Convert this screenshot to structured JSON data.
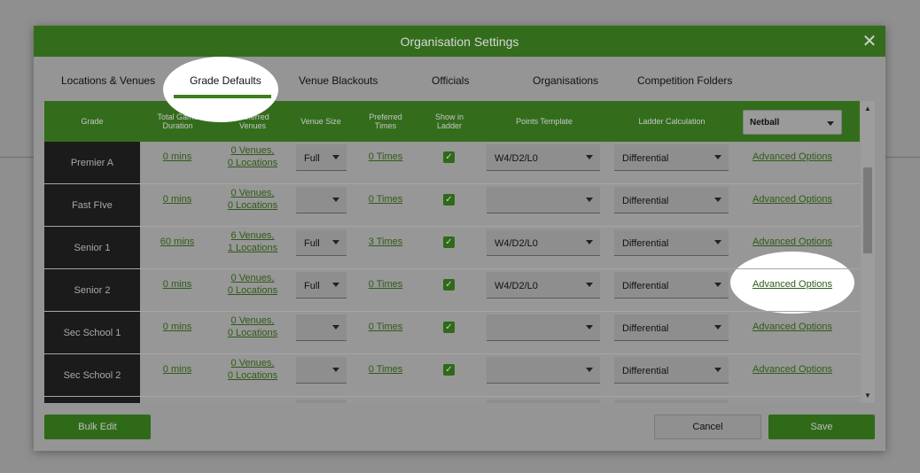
{
  "modal": {
    "title": "Organisation Settings",
    "close_glyph": "✕"
  },
  "tabs": [
    {
      "label": "Locations & Venues"
    },
    {
      "label": "Grade Defaults"
    },
    {
      "label": "Venue Blackouts"
    },
    {
      "label": "Officials"
    },
    {
      "label": "Organisations"
    },
    {
      "label": "Competition Folders"
    }
  ],
  "grid": {
    "headers": {
      "grade": "Grade",
      "duration": "Total Game Duration",
      "venues": "Preferred Venues",
      "venue_size": "Venue Size",
      "times": "Preferred Times",
      "ladder_show": "Show in Ladder",
      "points": "Points Template",
      "ladder_calc": "Ladder Calculation"
    },
    "sport_select": "Netball",
    "rows": [
      {
        "grade": "Premier A",
        "duration": "0 mins",
        "venues_1": "0 Venues,",
        "venues_2": "0 Locations",
        "venue_size": "Full",
        "times": "0 Times",
        "points": "W4/D2/L0",
        "ladder": "Differential",
        "advanced": "Advanced Options"
      },
      {
        "grade": "Fast FIve",
        "duration": "0 mins",
        "venues_1": "0 Venues,",
        "venues_2": "0 Locations",
        "venue_size": "",
        "times": "0 Times",
        "points": "",
        "ladder": "Differential",
        "advanced": "Advanced Options"
      },
      {
        "grade": "Senior 1",
        "duration": "60 mins",
        "venues_1": "6 Venues,",
        "venues_2": "1 Locations",
        "venue_size": "Full",
        "times": "3 Times",
        "points": "W4/D2/L0",
        "ladder": "Differential",
        "advanced": "Advanced Options"
      },
      {
        "grade": "Senior 2",
        "duration": "0 mins",
        "venues_1": "0 Venues,",
        "venues_2": "0 Locations",
        "venue_size": "Full",
        "times": "0 Times",
        "points": "W4/D2/L0",
        "ladder": "Differential",
        "advanced": "Advanced Options"
      },
      {
        "grade": "Sec School 1",
        "duration": "0 mins",
        "venues_1": "0 Venues,",
        "venues_2": "0 Locations",
        "venue_size": "",
        "times": "0 Times",
        "points": "",
        "ladder": "Differential",
        "advanced": "Advanced Options"
      },
      {
        "grade": "Sec School 2",
        "duration": "0 mins",
        "venues_1": "0 Venues,",
        "venues_2": "0 Locations",
        "venue_size": "",
        "times": "0 Times",
        "points": "",
        "ladder": "Differential",
        "advanced": "Advanced Options"
      }
    ],
    "check_glyph": "✓"
  },
  "footer": {
    "bulk_edit": "Bulk Edit",
    "cancel": "Cancel",
    "save": "Save"
  },
  "scroll": {
    "up": "▲",
    "down": "▼"
  }
}
